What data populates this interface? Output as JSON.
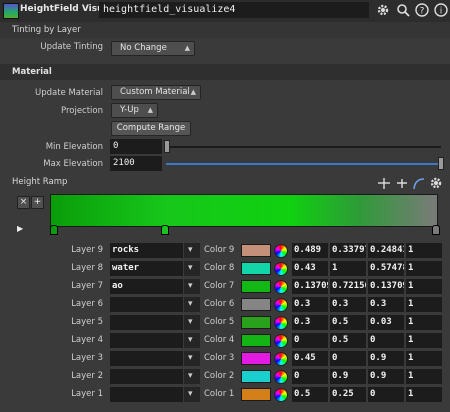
{
  "header": {
    "node_type": "HeightField Visualize",
    "node_name": "heightfield_visualize4",
    "icons": [
      "gear-icon",
      "search-icon",
      "help-icon",
      "info-icon"
    ]
  },
  "tinting": {
    "folder_label": "Tinting by Layer",
    "update_label": "Update Tinting",
    "update_value": "No Change"
  },
  "material": {
    "folder_label": "Material",
    "update_label": "Update Material",
    "update_value": "Custom Material",
    "projection_label": "Projection",
    "projection_value": "Y-Up",
    "compute_button": "Compute Range",
    "min_label": "Min Elevation",
    "min_value": "0",
    "max_label": "Max Elevation",
    "max_value": "2100"
  },
  "ramp": {
    "label": "Height Ramp",
    "remove_label": "×",
    "add_label": "+",
    "keys": [
      {
        "pos": 0.0,
        "color": "#0a9d0a"
      },
      {
        "pos": 0.29,
        "color": "#18c41b"
      },
      {
        "pos": 1.0,
        "color": "#7a7a7a"
      }
    ]
  },
  "layers": [
    {
      "label": "Layer 9",
      "name": "rocks",
      "color_label": "Color 9",
      "swatch": "#c4907a",
      "r": "0.489",
      "g": "0.33797",
      "b": "0.24841",
      "a": "1"
    },
    {
      "label": "Layer 8",
      "name": "water",
      "color_label": "Color 8",
      "swatch": "#12d6a8",
      "r": "0.43",
      "g": "1",
      "b": "0.57478",
      "a": "1"
    },
    {
      "label": "Layer 7",
      "name": "ao",
      "color_label": "Color 7",
      "swatch": "#14b814",
      "r": "0.13709",
      "g": "0.72156",
      "b": "0.13709",
      "a": "1"
    },
    {
      "label": "Layer 6",
      "name": "",
      "color_label": "Color 6",
      "swatch": "#858585",
      "r": "0.3",
      "g": "0.3",
      "b": "0.3",
      "a": "1"
    },
    {
      "label": "Layer 5",
      "name": "",
      "color_label": "Color 5",
      "swatch": "#2aa11a",
      "r": "0.3",
      "g": "0.5",
      "b": "0.03",
      "a": "1"
    },
    {
      "label": "Layer 4",
      "name": "",
      "color_label": "Color 4",
      "swatch": "#14b414",
      "r": "0",
      "g": "0.5",
      "b": "0",
      "a": "1"
    },
    {
      "label": "Layer 3",
      "name": "",
      "color_label": "Color 3",
      "swatch": "#e21ae2",
      "r": "0.45",
      "g": "0",
      "b": "0.9",
      "a": "1"
    },
    {
      "label": "Layer 2",
      "name": "",
      "color_label": "Color 2",
      "swatch": "#1ccfcf",
      "r": "0",
      "g": "0.9",
      "b": "0.9",
      "a": "1"
    },
    {
      "label": "Layer 1",
      "name": "",
      "color_label": "Color 1",
      "swatch": "#d3801a",
      "r": "0.5",
      "g": "0.25",
      "b": "0",
      "a": "1"
    }
  ]
}
